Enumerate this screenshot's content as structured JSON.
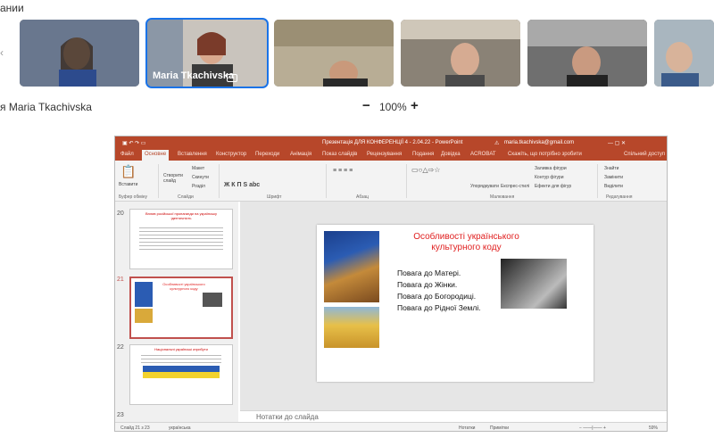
{
  "meeting": {
    "header_fragment": "ании",
    "presenter_label": "я Maria Tkachivska",
    "zoom_minus": "−",
    "zoom_value": "100%",
    "zoom_plus": "+",
    "participants": [
      {
        "name": "",
        "tone": "#5d6e87"
      },
      {
        "name": "Maria Tkachivska",
        "tone": "#6e7f8f"
      },
      {
        "name": "",
        "tone": "#8a7d64"
      },
      {
        "name": "",
        "tone": "#7c7568"
      },
      {
        "name": "",
        "tone": "#757575"
      },
      {
        "name": "",
        "tone": "#8b9aa6"
      }
    ]
  },
  "ppt": {
    "filename": "Презентація ДЛЯ КОНФЕРЕНЦІЇ 4 - 2.04.22 - PowerPoint",
    "account": "maria.tkachivska@gmail.com",
    "tabs": [
      "Файл",
      "Основне",
      "Вставлення",
      "Конструктор",
      "Переходи",
      "Анімація",
      "Показ слайдів",
      "Рецензування",
      "Подання",
      "Довідка",
      "ACROBAT",
      "Скажіть, що потрібно зробити"
    ],
    "share": "Спільний доступ",
    "ribbon": {
      "paste": "Вставити",
      "clipboard": "Буфер обміну",
      "new_slide": "Створити слайд",
      "layout": "Макет",
      "reset": "Скинути",
      "section": "Розділ",
      "slides_group": "Слайди",
      "font_group": "Шрифт",
      "paragraph_group": "Абзац",
      "drawing_group": "Малювання",
      "arrange": "Упорядкувати",
      "quick_styles": "Експрес-стилі",
      "shape_fill": "Заливка фігури",
      "shape_outline": "Контур фігури",
      "shape_effects": "Ефекти для фігур",
      "find": "Знайти",
      "replace": "Замінити",
      "select": "Виділити",
      "editing_group": "Редагування"
    },
    "thumbs": [
      {
        "num": "20",
        "title": "Вплив російської пропаганди на українську ідентичність"
      },
      {
        "num": "21",
        "title": "Особливості українського культурного коду"
      },
      {
        "num": "22",
        "title": "Національні українські атрибути"
      },
      {
        "num": "23",
        "title": ""
      }
    ],
    "slide": {
      "title": "Особливості українського культурного коду",
      "items": [
        "Повага до Матері.",
        "Повага до Жінки.",
        "Повага до Богородиці.",
        "Повага до Рідної Землі."
      ]
    },
    "notes_placeholder": "Нотатки до слайда",
    "status": {
      "slide_of": "Слайд 21 з 23",
      "language": "українська",
      "notes_btn": "Нотатки",
      "comments_btn": "Примітки",
      "zoom": "59%"
    }
  }
}
